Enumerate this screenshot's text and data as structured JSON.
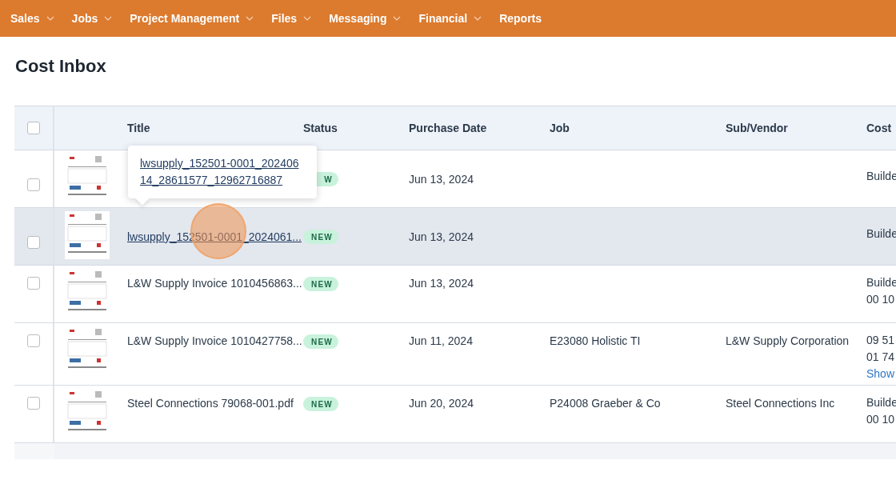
{
  "nav": [
    {
      "label": "Sales",
      "dropdown": true
    },
    {
      "label": "Jobs",
      "dropdown": true
    },
    {
      "label": "Project Management",
      "dropdown": true
    },
    {
      "label": "Files",
      "dropdown": true
    },
    {
      "label": "Messaging",
      "dropdown": true
    },
    {
      "label": "Financial",
      "dropdown": true
    },
    {
      "label": "Reports",
      "dropdown": false
    }
  ],
  "page_title": "Cost Inbox",
  "table": {
    "select_all_checked": false,
    "columns": [
      "Title",
      "Status",
      "Purchase Date",
      "Job",
      "Sub/Vendor",
      "Cost"
    ],
    "rows": [
      {
        "checked": false,
        "highlighted": false,
        "status": "W",
        "purchase_date": "Jun 13, 2024",
        "cost_code": [
          "Builde"
        ]
      },
      {
        "checked": false,
        "highlighted": true,
        "title": "lwsupply_152501-0001_2024061...",
        "title_link": true,
        "status": "NEW",
        "purchase_date": "Jun 13, 2024",
        "cost_code": [
          "Builde"
        ]
      },
      {
        "checked": false,
        "highlighted": false,
        "title": "L&W Supply Invoice 1010456863...",
        "title_link": false,
        "status": "NEW",
        "purchase_date": "Jun 13, 2024",
        "cost_code": [
          "Builde",
          "00 10"
        ]
      },
      {
        "checked": false,
        "highlighted": false,
        "title": "L&W Supply Invoice 1010427758...",
        "title_link": false,
        "status": "NEW",
        "purchase_date": "Jun 11, 2024",
        "job": "E23080 Holistic TI",
        "vendor": "L&W Supply Corporation",
        "cost_code": [
          "09 51",
          "01 74"
        ],
        "cost_link": "Show"
      },
      {
        "checked": false,
        "highlighted": false,
        "title": "Steel Connections 79068-001.pdf",
        "title_link": false,
        "status": "NEW",
        "purchase_date": "Jun 20, 2024",
        "job": "P24008 Graeber & Co",
        "vendor": "Steel Connections Inc",
        "cost_code": [
          "Builde",
          "00 10"
        ]
      }
    ],
    "tooltip": "lwsupply_152501-0001_20240614_28611577_12962716887"
  }
}
